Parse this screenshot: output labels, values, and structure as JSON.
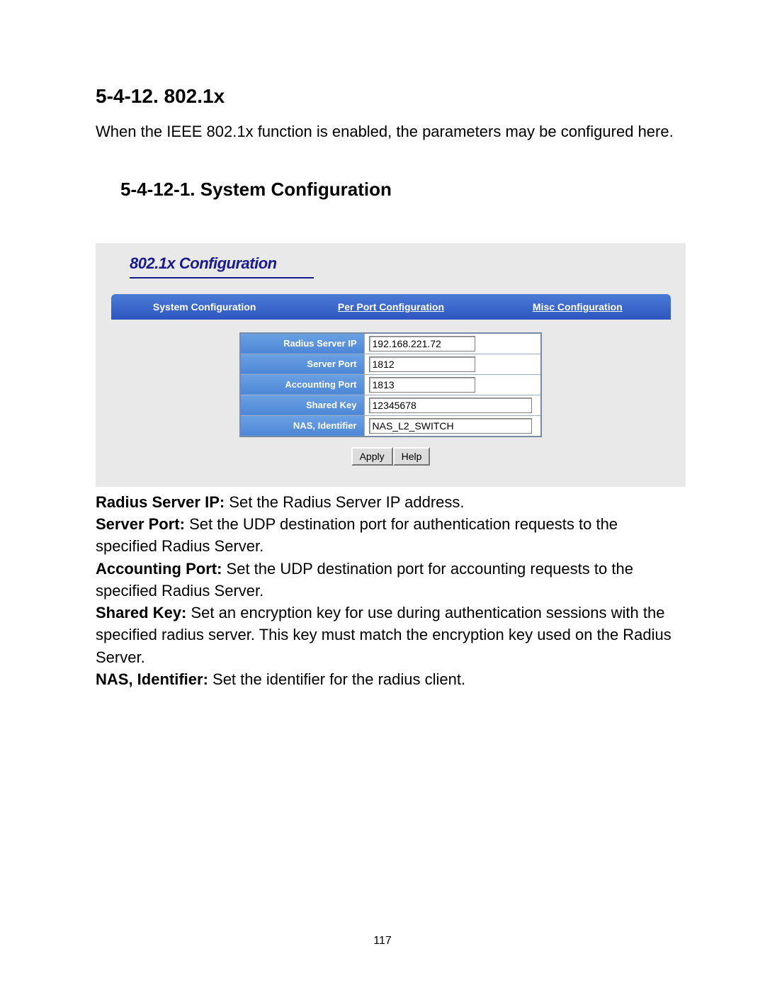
{
  "heading1": "5-4-12. 802.1x",
  "intro": "When the IEEE 802.1x function is enabled, the parameters may be configured here.",
  "heading2": "5-4-12-1. System Configuration",
  "panel": {
    "title": "802.1x Configuration",
    "tabs": {
      "system": "System Configuration",
      "perport": "Per Port Configuration",
      "misc": "Misc Configuration"
    },
    "fields": {
      "radius_ip_label": "Radius Server IP",
      "radius_ip_value": "192.168.221.72",
      "server_port_label": "Server Port",
      "server_port_value": "1812",
      "accounting_port_label": "Accounting Port",
      "accounting_port_value": "1813",
      "shared_key_label": "Shared Key",
      "shared_key_value": "12345678",
      "nas_label": "NAS, Identifier",
      "nas_value": "NAS_L2_SWITCH"
    },
    "buttons": {
      "apply": "Apply",
      "help": "Help"
    }
  },
  "descs": {
    "radius_ip_b": "Radius Server IP:",
    "radius_ip_t": " Set the Radius Server IP address.",
    "server_port_b": "Server Port:",
    "server_port_t": " Set the UDP destination port for authentication requests to the specified Radius Server.",
    "accounting_port_b": "Accounting Port:",
    "accounting_port_t": " Set the UDP destination port for accounting requests to the specified Radius Server.",
    "shared_key_b": "Shared Key:",
    "shared_key_t": " Set an encryption key for use during authentication sessions with the specified radius server. This key must match the encryption key used on the Radius Server.",
    "nas_b": "NAS, Identifier:",
    "nas_t": " Set the identifier for the radius client."
  },
  "page_number": "117"
}
